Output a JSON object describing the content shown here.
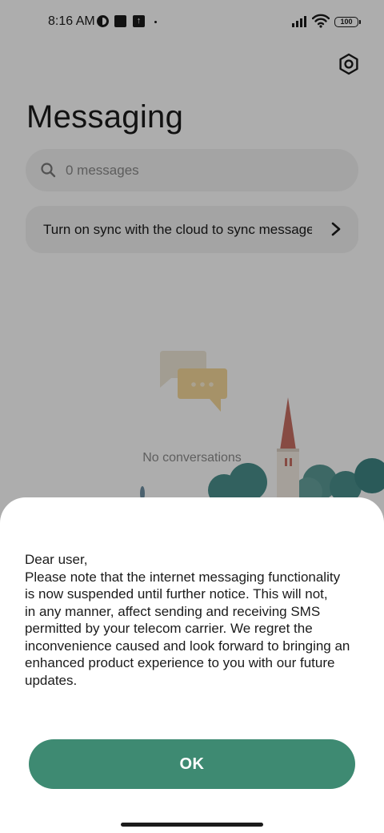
{
  "status_bar": {
    "time": "8:16 AM",
    "upload_glyph": "↑",
    "battery_level": "100",
    "icons": [
      "data-saver-icon",
      "square-notification-icon",
      "upload-icon",
      "signal-icon",
      "wifi-icon",
      "battery-icon"
    ]
  },
  "header": {
    "title": "Messaging",
    "settings_icon": "settings-hexagon-icon"
  },
  "search": {
    "placeholder": "0 messages"
  },
  "sync_banner": {
    "text": "Turn on sync with the cloud to sync messages"
  },
  "empty_state": {
    "text": "No conversations"
  },
  "dialog": {
    "message_lines": [
      "Dear user,",
      "Please note that the internet messaging functionality",
      "is now suspended until further notice. This will not,",
      "in any manner, affect sending and receiving SMS",
      "permitted by your telecom carrier. We regret the",
      "inconvenience caused and look forward to bringing an",
      "enhanced product experience to you with our future",
      "updates."
    ],
    "ok_label": "OK"
  },
  "colors": {
    "accent": "#3e8a72",
    "overlay": "rgba(0,0,0,0.32)"
  }
}
